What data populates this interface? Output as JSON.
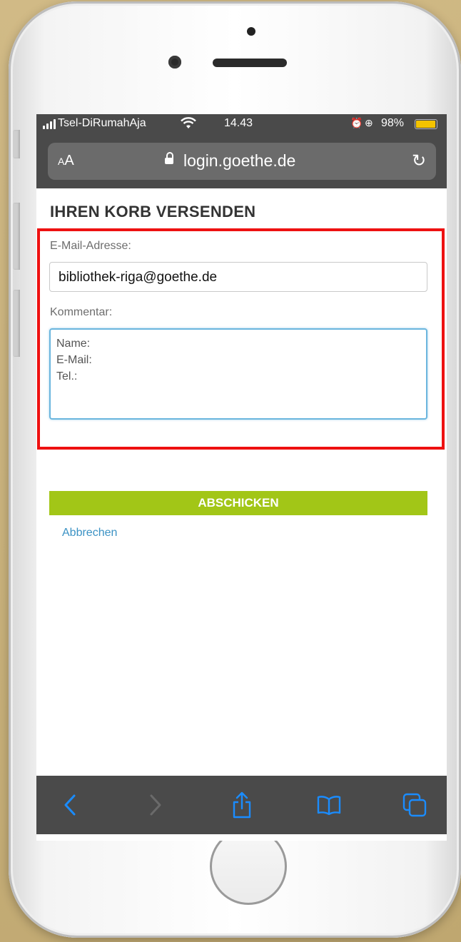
{
  "status_bar": {
    "carrier": "Tsel-DiRumahAja",
    "time": "14.43",
    "battery": "98%",
    "battery_level": 0.98
  },
  "address_bar": {
    "text_size_label": "AA",
    "domain": "login.goethe.de"
  },
  "form": {
    "title": "IHREN KORB VERSENDEN",
    "email_label": "E-Mail-Adresse:",
    "email_value": "bibliothek-riga@goethe.de",
    "comment_label": "Kommentar:",
    "comment_lines": [
      "Name:",
      "E-Mail:",
      "Tel.:"
    ],
    "submit_label": "ABSCHICKEN",
    "cancel_label": "Abbrechen"
  },
  "colors": {
    "highlight_border": "#ee1111",
    "submit_bg": "#a2c617",
    "link": "#3b92c4",
    "browser_chrome": "#4a4a4a",
    "ios_blue": "#1a8cff"
  },
  "toolbar": {
    "icons": [
      "back-icon",
      "forward-icon",
      "share-icon",
      "bookmarks-icon",
      "tabs-icon"
    ]
  }
}
